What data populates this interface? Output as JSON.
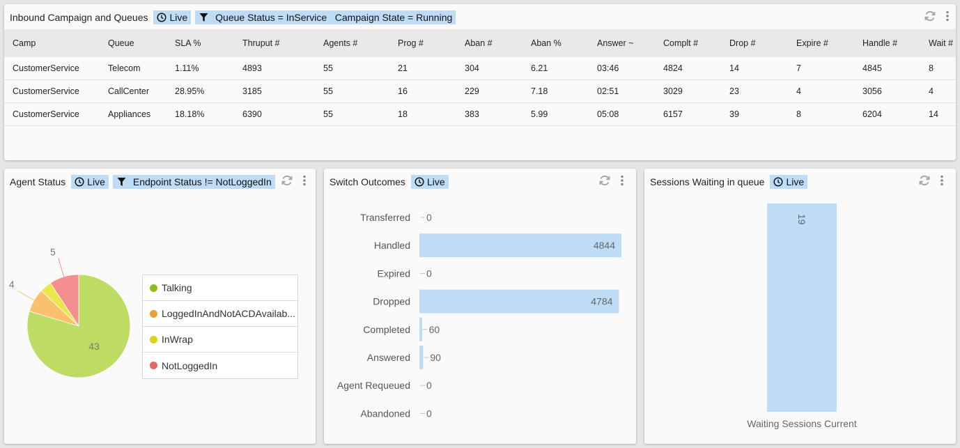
{
  "queues_panel": {
    "title": "Inbound Campaign and Queues",
    "live_label": "Live",
    "filter_label": "Queue Status = InService   Campaign State = Running",
    "columns": [
      "Camp",
      "Queue",
      "SLA %",
      "Thruput #",
      "Agents #",
      "Prog #",
      "Aban #",
      "Aban %",
      "Answer ~",
      "Complt #",
      "Drop #",
      "Expire #",
      "Handle #",
      "Wait #"
    ],
    "rows": [
      [
        "CustomerService",
        "Telecom",
        "1.11%",
        "4893",
        "55",
        "21",
        "304",
        "6.21",
        "03:46",
        "4824",
        "14",
        "7",
        "4845",
        "8"
      ],
      [
        "CustomerService",
        "CallCenter",
        "28.95%",
        "3185",
        "55",
        "16",
        "229",
        "7.18",
        "02:51",
        "3029",
        "23",
        "4",
        "3056",
        "4"
      ],
      [
        "CustomerService",
        "Appliances",
        "18.18%",
        "6390",
        "55",
        "18",
        "383",
        "5.99",
        "05:08",
        "6157",
        "39",
        "8",
        "6204",
        "14"
      ]
    ]
  },
  "agent_panel": {
    "title": "Agent Status",
    "live_label": "Live",
    "filter_label": "Endpoint Status != NotLoggedIn",
    "chart_data": {
      "type": "pie",
      "slices": [
        {
          "name": "Talking",
          "value": 43,
          "color": "#bddc63",
          "label": "43"
        },
        {
          "name": "LoggedInAndNotACDAvailab...",
          "value": 4,
          "color": "#f9c06e",
          "label": "4"
        },
        {
          "name": "InWrap",
          "value": 2,
          "color": "#e8e84a",
          "label": ""
        },
        {
          "name": "NotLoggedIn",
          "value": 5,
          "color": "#f58f8f",
          "label": "5"
        }
      ],
      "legend_dots": [
        "#8fbf1d",
        "#f0a030",
        "#d6d61a",
        "#ea6464"
      ],
      "legend_position": "right"
    }
  },
  "switch_panel": {
    "title": "Switch Outcomes",
    "live_label": "Live",
    "chart_data": {
      "type": "bar",
      "orientation": "horizontal",
      "categories": [
        "Transferred",
        "Handled",
        "Expired",
        "Dropped",
        "Completed",
        "Answered",
        "Agent Requeued",
        "Abandoned"
      ],
      "values": [
        0,
        4844,
        0,
        4784,
        60,
        90,
        0,
        0
      ],
      "value_labels": [
        "0",
        "4844",
        "0",
        "4784",
        "60",
        "90",
        "0",
        "0"
      ],
      "xlim": [
        0,
        4844
      ],
      "bar_color": "#bfdcf7"
    }
  },
  "sessions_panel": {
    "title": "Sessions Waiting in queue",
    "live_label": "Live",
    "chart_data": {
      "type": "bar",
      "categories": [
        "Waiting Sessions Current"
      ],
      "values": [
        19
      ],
      "value_labels": [
        "19"
      ],
      "bar_color": "#bfdcf7"
    }
  }
}
